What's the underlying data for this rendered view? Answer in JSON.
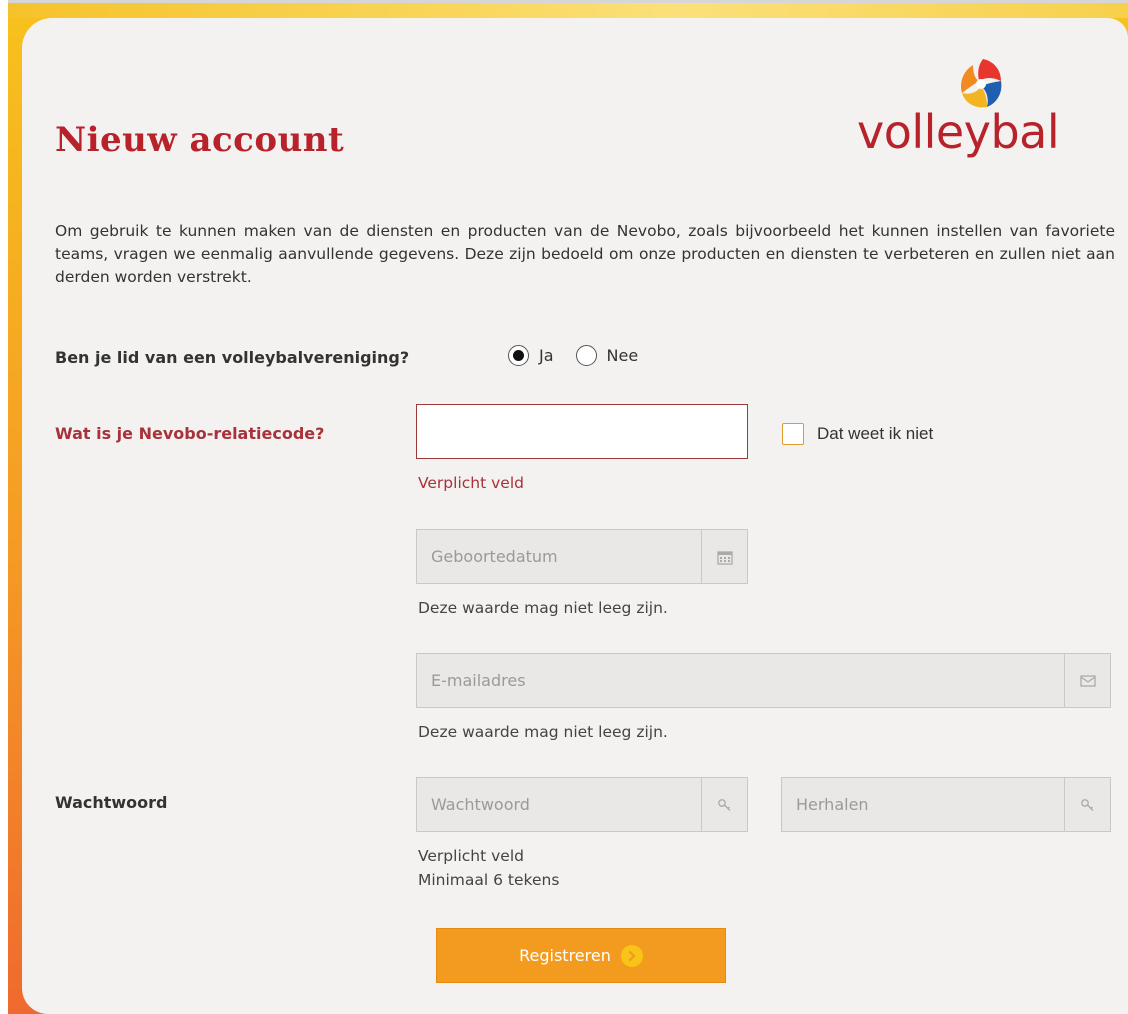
{
  "header": {
    "title": "Nieuw account",
    "logo_text": "volleybal"
  },
  "intro": "Om gebruik te kunnen maken van de diensten en producten van de Nevobo, zoals bijvoorbeeld het kunnen instellen van favoriete teams, vragen we eenmalig aanvullende gegevens. Deze zijn bedoeld om onze producten en diensten te verbeteren en zullen niet aan derden worden verstrekt.",
  "membership": {
    "label": "Ben je lid van een volleybalvereniging?",
    "options": [
      {
        "label": "Ja",
        "selected": true
      },
      {
        "label": "Nee",
        "selected": false
      }
    ]
  },
  "relatiecode": {
    "label": "Wat is je Nevobo-relatiecode?",
    "value": "",
    "placeholder": "",
    "error": "Verplicht veld",
    "unknown_checkbox_label": "Dat weet ik niet",
    "unknown_checked": false
  },
  "birthdate": {
    "placeholder": "Geboortedatum",
    "value": "",
    "icon": "calendar-icon",
    "error": "Deze waarde mag niet leeg zijn."
  },
  "email": {
    "placeholder": "E-mailadres",
    "value": "",
    "icon": "envelope-icon",
    "error": "Deze waarde mag niet leeg zijn."
  },
  "password": {
    "label": "Wachtwoord",
    "placeholder": "Wachtwoord",
    "repeat_placeholder": "Herhalen",
    "icon": "key-icon",
    "error_1": "Verplicht veld",
    "error_2": "Minimaal 6 tekens"
  },
  "submit": {
    "label": "Registreren",
    "icon": "arrow-circle-icon"
  },
  "colors": {
    "brand_red": "#b7222b",
    "accent_orange": "#f39b1f",
    "error_red": "#a8323a",
    "checkbox_border": "#e19b2c"
  }
}
